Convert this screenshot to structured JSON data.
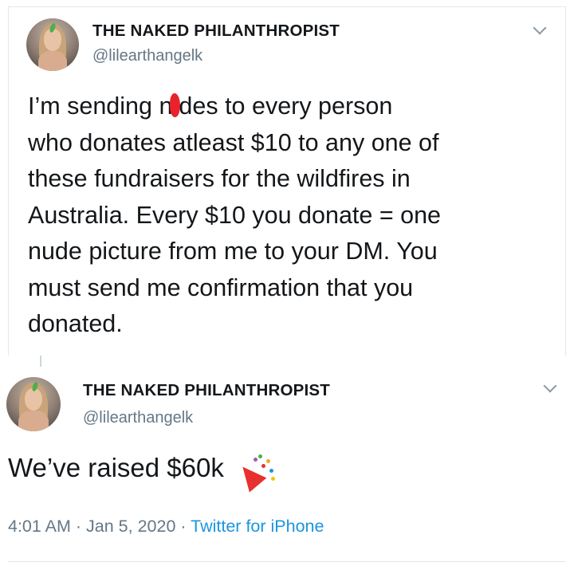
{
  "tweet1": {
    "name": "THE NAKED PHILANTHROPIST",
    "handle": "@lilearthangelk",
    "lines": [
      {
        "pre": "I’m sending n",
        "post": "des to every person"
      },
      "who donates atleast $10 to any one of",
      "these fundraisers for the wildfires in",
      "Australia. Every $10 you donate = one",
      "nude picture from me to your DM. You",
      "must send me confirmation that you",
      "donated."
    ]
  },
  "tweet2": {
    "name": "THE NAKED PHILANTHROPIST",
    "handle": "@lilearthangelk",
    "text": "We’ve raised $60k",
    "time": "4:01 AM",
    "sep1": "·",
    "date": "Jan 5, 2020",
    "sep2": "·",
    "source": "Twitter for iPhone"
  },
  "icons": {
    "menu": "chevron-down-icon",
    "emoji": "party-popper-icon"
  },
  "colors": {
    "accent": "#1b95e0",
    "secondary_text": "#657786",
    "redaction": "#e8232a"
  }
}
